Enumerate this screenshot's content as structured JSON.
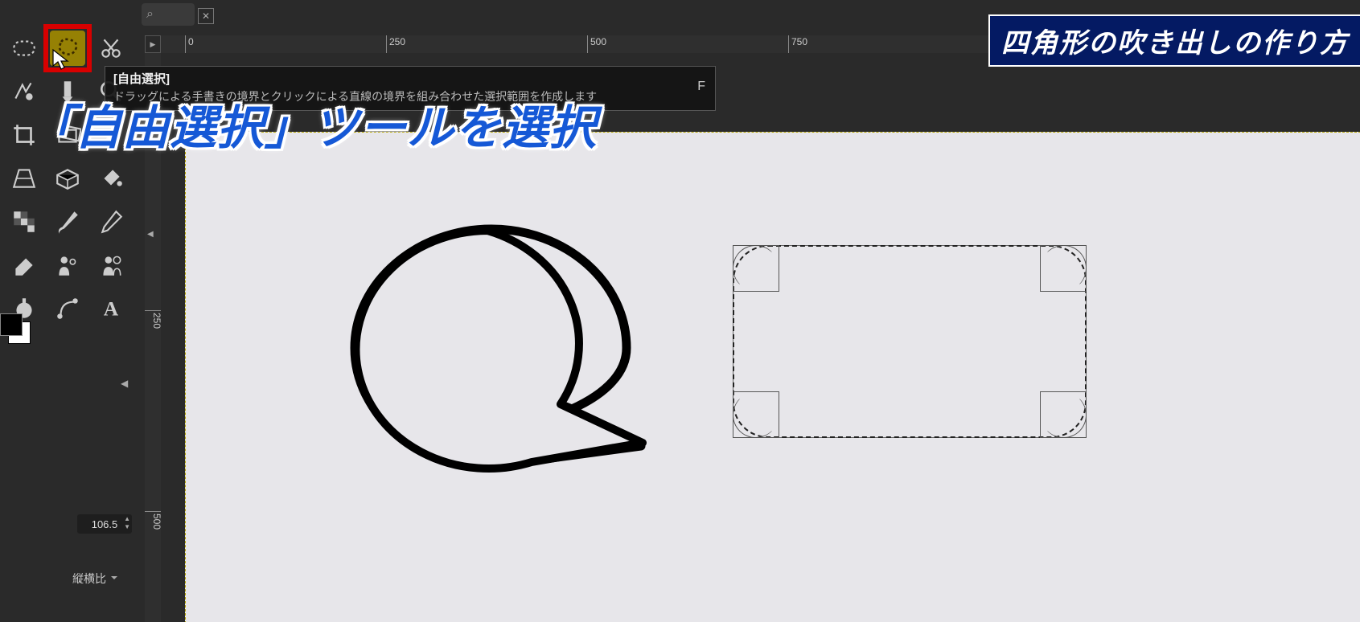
{
  "banner": "四角形の吹き出しの作り方",
  "caption": "「自由選択」ツールを選択",
  "tooltip": {
    "title": "[自由選択]",
    "desc": "ドラッグによる手書きの境界とクリックによる直線の境界を組み合わせた選択範囲を作成します",
    "shortcut": "F"
  },
  "toolbox": {
    "tools": [
      {
        "name": "rect-select"
      },
      {
        "name": "free-select",
        "highlighted": true
      },
      {
        "name": "scissors-select"
      },
      {
        "name": "fuzzy-select"
      },
      {
        "name": "color-picker"
      },
      {
        "name": "magnify"
      },
      {
        "name": "crop"
      },
      {
        "name": "rotate"
      },
      {
        "name": "measure"
      },
      {
        "name": "perspective"
      },
      {
        "name": "transform-3d"
      },
      {
        "name": "bucket-fill"
      },
      {
        "name": "checkerboard"
      },
      {
        "name": "paintbrush"
      },
      {
        "name": "pencil"
      },
      {
        "name": "eraser"
      },
      {
        "name": "clone"
      },
      {
        "name": "heal"
      },
      {
        "name": "smudge"
      },
      {
        "name": "path"
      },
      {
        "name": "text"
      }
    ],
    "zoom_value": "106.5",
    "aspect_label": "縦横比"
  },
  "ruler": {
    "h_ticks": [
      {
        "pos": 0,
        "label": "0"
      },
      {
        "pos": 250,
        "label": "250"
      },
      {
        "pos": 500,
        "label": "500"
      },
      {
        "pos": 750,
        "label": "750"
      }
    ],
    "v_ticks": [
      {
        "pos": 250,
        "label": "250"
      },
      {
        "pos": 500,
        "label": "500"
      }
    ]
  },
  "search_glyph": "⌕"
}
